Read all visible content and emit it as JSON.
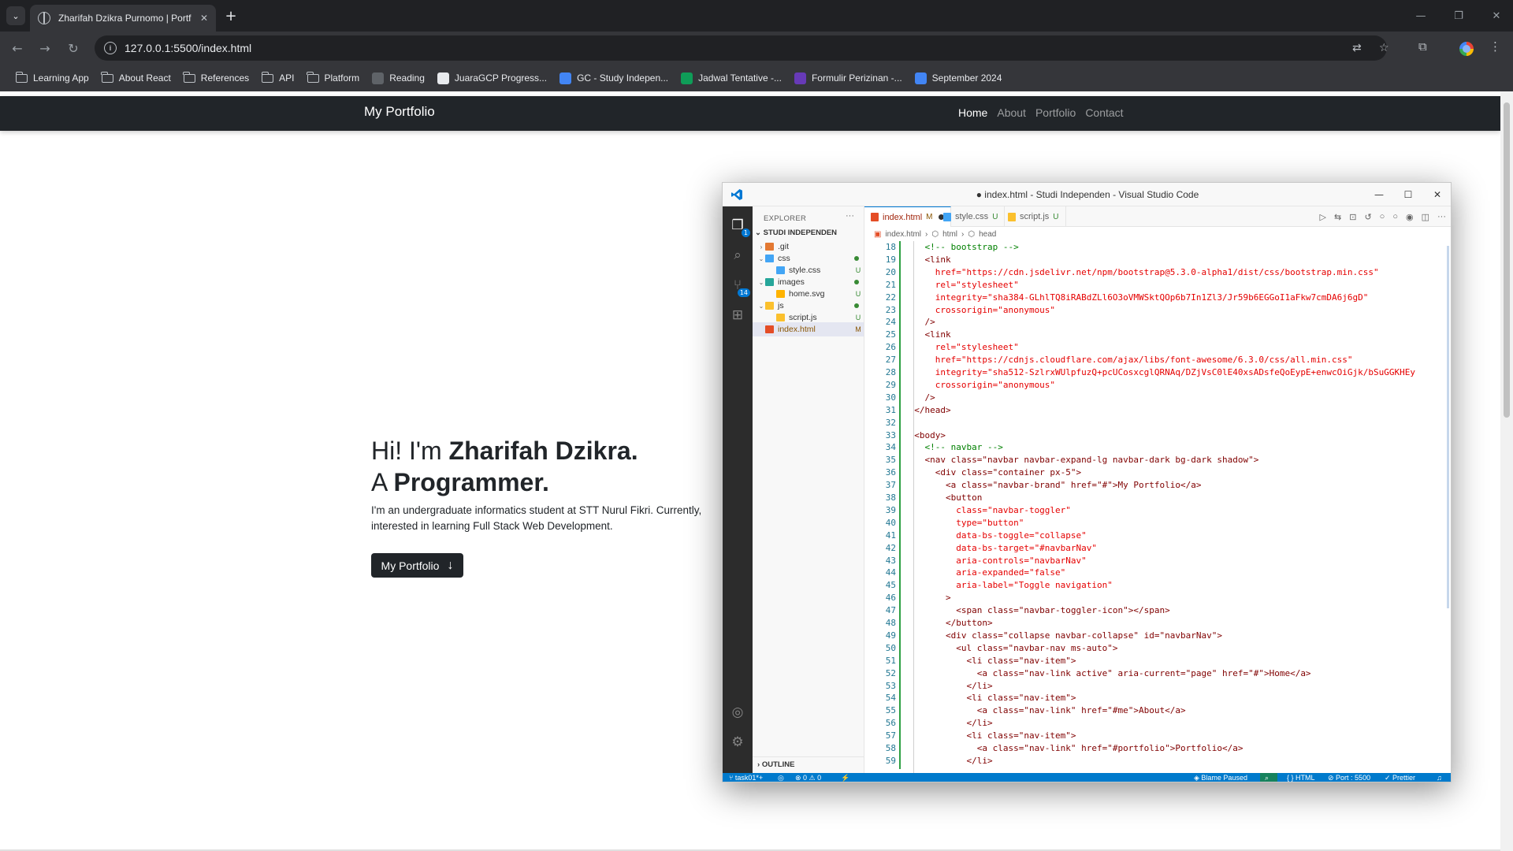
{
  "browser": {
    "tab_title": "Zharifah Dzikra Purnomo | Portf",
    "url": "127.0.0.1:5500/index.html",
    "bookmarks": [
      {
        "label": "Learning App",
        "icon": "folder-icon"
      },
      {
        "label": "About React",
        "icon": "folder-icon"
      },
      {
        "label": "References",
        "icon": "folder-icon"
      },
      {
        "label": "API",
        "icon": "folder-icon"
      },
      {
        "label": "Platform",
        "icon": "folder-icon"
      },
      {
        "label": "Reading",
        "icon": "reading-icon",
        "color": "#5f6368"
      },
      {
        "label": "JuaraGCP Progress...",
        "icon": "gcp-icon",
        "color": "#e8eaed"
      },
      {
        "label": "GC - Study Indepen...",
        "icon": "classroom-icon",
        "color": "#4285f4"
      },
      {
        "label": "Jadwal Tentative -...",
        "icon": "sheets-icon",
        "color": "#0f9d58"
      },
      {
        "label": "Formulir Perizinan -...",
        "icon": "forms-icon",
        "color": "#673ab7"
      },
      {
        "label": "September 2024",
        "icon": "calendar-icon",
        "color": "#4285f4"
      }
    ]
  },
  "site": {
    "brand": "My Portfolio",
    "nav": [
      "Home",
      "About",
      "Portfolio",
      "Contact"
    ],
    "hero_hi": "Hi! I'm ",
    "hero_name": "Zharifah Dzikra.",
    "hero_a": "A ",
    "hero_role": "Programmer.",
    "hero_desc": "I'm an undergraduate informatics student at STT Nurul Fikri. Currently, interested in learning Full Stack Web Development.",
    "hero_button": "My Portfolio"
  },
  "vscode": {
    "title": "● index.html - Studi Independen - Visual Studio Code",
    "explorer_label": "EXPLORER",
    "workspace": "STUDI INDEPENDEN",
    "outline_label": "OUTLINE",
    "tree": [
      {
        "name": ".git",
        "indent": 0,
        "chevron": "›",
        "status": "",
        "dot": false,
        "icon_color": "#e37933"
      },
      {
        "name": "css",
        "indent": 0,
        "chevron": "⌄",
        "status": "",
        "dot": true,
        "icon_color": "#42a5f5"
      },
      {
        "name": "style.css",
        "indent": 1,
        "chevron": "",
        "status": "U",
        "dot": false,
        "icon_color": "#42a5f5"
      },
      {
        "name": "images",
        "indent": 0,
        "chevron": "⌄",
        "status": "",
        "dot": true,
        "icon_color": "#26a69a"
      },
      {
        "name": "home.svg",
        "indent": 1,
        "chevron": "",
        "status": "U",
        "dot": false,
        "icon_color": "#ffb300"
      },
      {
        "name": "js",
        "indent": 0,
        "chevron": "⌄",
        "status": "",
        "dot": true,
        "icon_color": "#fbc02d"
      },
      {
        "name": "script.js",
        "indent": 1,
        "chevron": "",
        "status": "U",
        "dot": false,
        "icon_color": "#fbc02d"
      },
      {
        "name": "index.html",
        "indent": 0,
        "chevron": "",
        "status": "M",
        "dot": false,
        "icon_color": "#e44d26",
        "selected": true
      }
    ],
    "tabs": [
      {
        "name": "index.html",
        "status": "M",
        "icon_color": "#e44d26",
        "active": true
      },
      {
        "name": "style.css",
        "status": "U",
        "icon_color": "#42a5f5"
      },
      {
        "name": "script.js",
        "status": "U",
        "icon_color": "#fbc02d"
      }
    ],
    "breadcrumb": [
      "index.html",
      "html",
      "head"
    ],
    "code": [
      {
        "n": "18",
        "t": "    <!-- bootstrap -->"
      },
      {
        "n": "19",
        "t": "    <link"
      },
      {
        "n": "20",
        "t": "      href=\"https://cdn.jsdelivr.net/npm/bootstrap@5.3.0-alpha1/dist/css/bootstrap.min.css\""
      },
      {
        "n": "21",
        "t": "      rel=\"stylesheet\""
      },
      {
        "n": "22",
        "t": "      integrity=\"sha384-GLhlTQ8iRABdZLl6O3oVMWSktQOp6b7In1Zl3/Jr59b6EGGoI1aFkw7cmDA6j6gD\""
      },
      {
        "n": "23",
        "t": "      crossorigin=\"anonymous\""
      },
      {
        "n": "24",
        "t": "    />"
      },
      {
        "n": "25",
        "t": "    <link"
      },
      {
        "n": "26",
        "t": "      rel=\"stylesheet\""
      },
      {
        "n": "27",
        "t": "      href=\"https://cdnjs.cloudflare.com/ajax/libs/font-awesome/6.3.0/css/all.min.css\""
      },
      {
        "n": "28",
        "t": "      integrity=\"sha512-SzlrxWUlpfuzQ+pcUCosxcglQRNAq/DZjVsC0lE40xsADsfeQoEypE+enwcOiGjk/bSuGGKHEy"
      },
      {
        "n": "29",
        "t": "      crossorigin=\"anonymous\""
      },
      {
        "n": "30",
        "t": "    />"
      },
      {
        "n": "31",
        "t": "  </head>"
      },
      {
        "n": "32",
        "t": ""
      },
      {
        "n": "33",
        "t": "  <body>"
      },
      {
        "n": "34",
        "t": "    <!-- navbar -->"
      },
      {
        "n": "35",
        "t": "    <nav class=\"navbar navbar-expand-lg navbar-dark bg-dark shadow\">"
      },
      {
        "n": "36",
        "t": "      <div class=\"container px-5\">"
      },
      {
        "n": "37",
        "t": "        <a class=\"navbar-brand\" href=\"#\">My Portfolio</a>"
      },
      {
        "n": "38",
        "t": "        <button"
      },
      {
        "n": "39",
        "t": "          class=\"navbar-toggler\""
      },
      {
        "n": "40",
        "t": "          type=\"button\""
      },
      {
        "n": "41",
        "t": "          data-bs-toggle=\"collapse\""
      },
      {
        "n": "42",
        "t": "          data-bs-target=\"#navbarNav\""
      },
      {
        "n": "43",
        "t": "          aria-controls=\"navbarNav\""
      },
      {
        "n": "44",
        "t": "          aria-expanded=\"false\""
      },
      {
        "n": "45",
        "t": "          aria-label=\"Toggle navigation\""
      },
      {
        "n": "46",
        "t": "        >"
      },
      {
        "n": "47",
        "t": "          <span class=\"navbar-toggler-icon\"></span>"
      },
      {
        "n": "48",
        "t": "        </button>"
      },
      {
        "n": "49",
        "t": "        <div class=\"collapse navbar-collapse\" id=\"navbarNav\">"
      },
      {
        "n": "50",
        "t": "          <ul class=\"navbar-nav ms-auto\">"
      },
      {
        "n": "51",
        "t": "            <li class=\"nav-item\">"
      },
      {
        "n": "52",
        "t": "              <a class=\"nav-link active\" aria-current=\"page\" href=\"#\">Home</a>"
      },
      {
        "n": "53",
        "t": "            </li>"
      },
      {
        "n": "54",
        "t": "            <li class=\"nav-item\">"
      },
      {
        "n": "55",
        "t": "              <a class=\"nav-link\" href=\"#me\">About</a>"
      },
      {
        "n": "56",
        "t": "            </li>"
      },
      {
        "n": "57",
        "t": "            <li class=\"nav-item\">"
      },
      {
        "n": "58",
        "t": "              <a class=\"nav-link\" href=\"#portfolio\">Portfolio</a>"
      },
      {
        "n": "59",
        "t": "            </li>"
      }
    ],
    "status": {
      "branch": "task01*+",
      "problems": "⊗ 0 ⚠ 0",
      "blame": "Blame Paused",
      "language": "HTML",
      "port": "Port : 5500",
      "prettier": "✓ Prettier"
    },
    "scm_badge": "14",
    "explorer_badge": "1"
  },
  "colors": {
    "accent": "#007acc",
    "navbar_dark": "#212529"
  }
}
